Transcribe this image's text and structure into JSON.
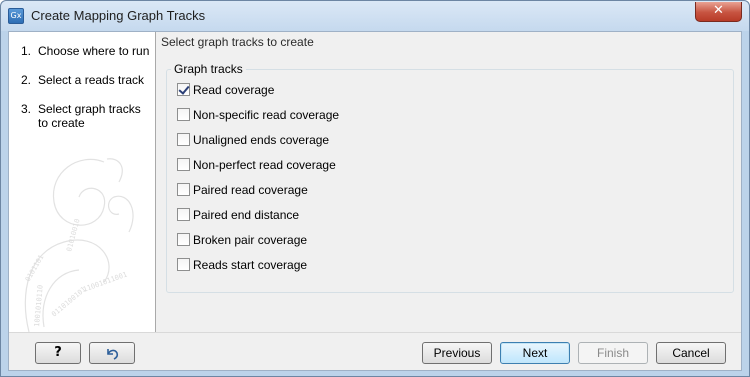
{
  "window": {
    "icon_text": "Gx",
    "title": "Create Mapping Graph Tracks",
    "close_glyph": "✕"
  },
  "steps": [
    {
      "number": "1.",
      "label": "Choose where to run"
    },
    {
      "number": "2.",
      "label": "Select a reads track"
    },
    {
      "number": "3.",
      "label": "Select graph tracks to create"
    }
  ],
  "content": {
    "header": "Select graph tracks to create",
    "group_title": "Graph tracks",
    "tracks": [
      {
        "label": "Read coverage",
        "checked": true
      },
      {
        "label": "Non-specific read coverage",
        "checked": false
      },
      {
        "label": "Unaligned ends coverage",
        "checked": false
      },
      {
        "label": "Non-perfect read coverage",
        "checked": false
      },
      {
        "label": "Paired read coverage",
        "checked": false
      },
      {
        "label": "Paired end distance",
        "checked": false
      },
      {
        "label": "Broken pair coverage",
        "checked": false
      },
      {
        "label": "Reads start coverage",
        "checked": false
      }
    ]
  },
  "footer": {
    "help_label": "?",
    "reset_icon": "reset-arrow-icon",
    "previous_label": "Previous",
    "next_label": "Next",
    "finish_label": "Finish",
    "cancel_label": "Cancel"
  }
}
